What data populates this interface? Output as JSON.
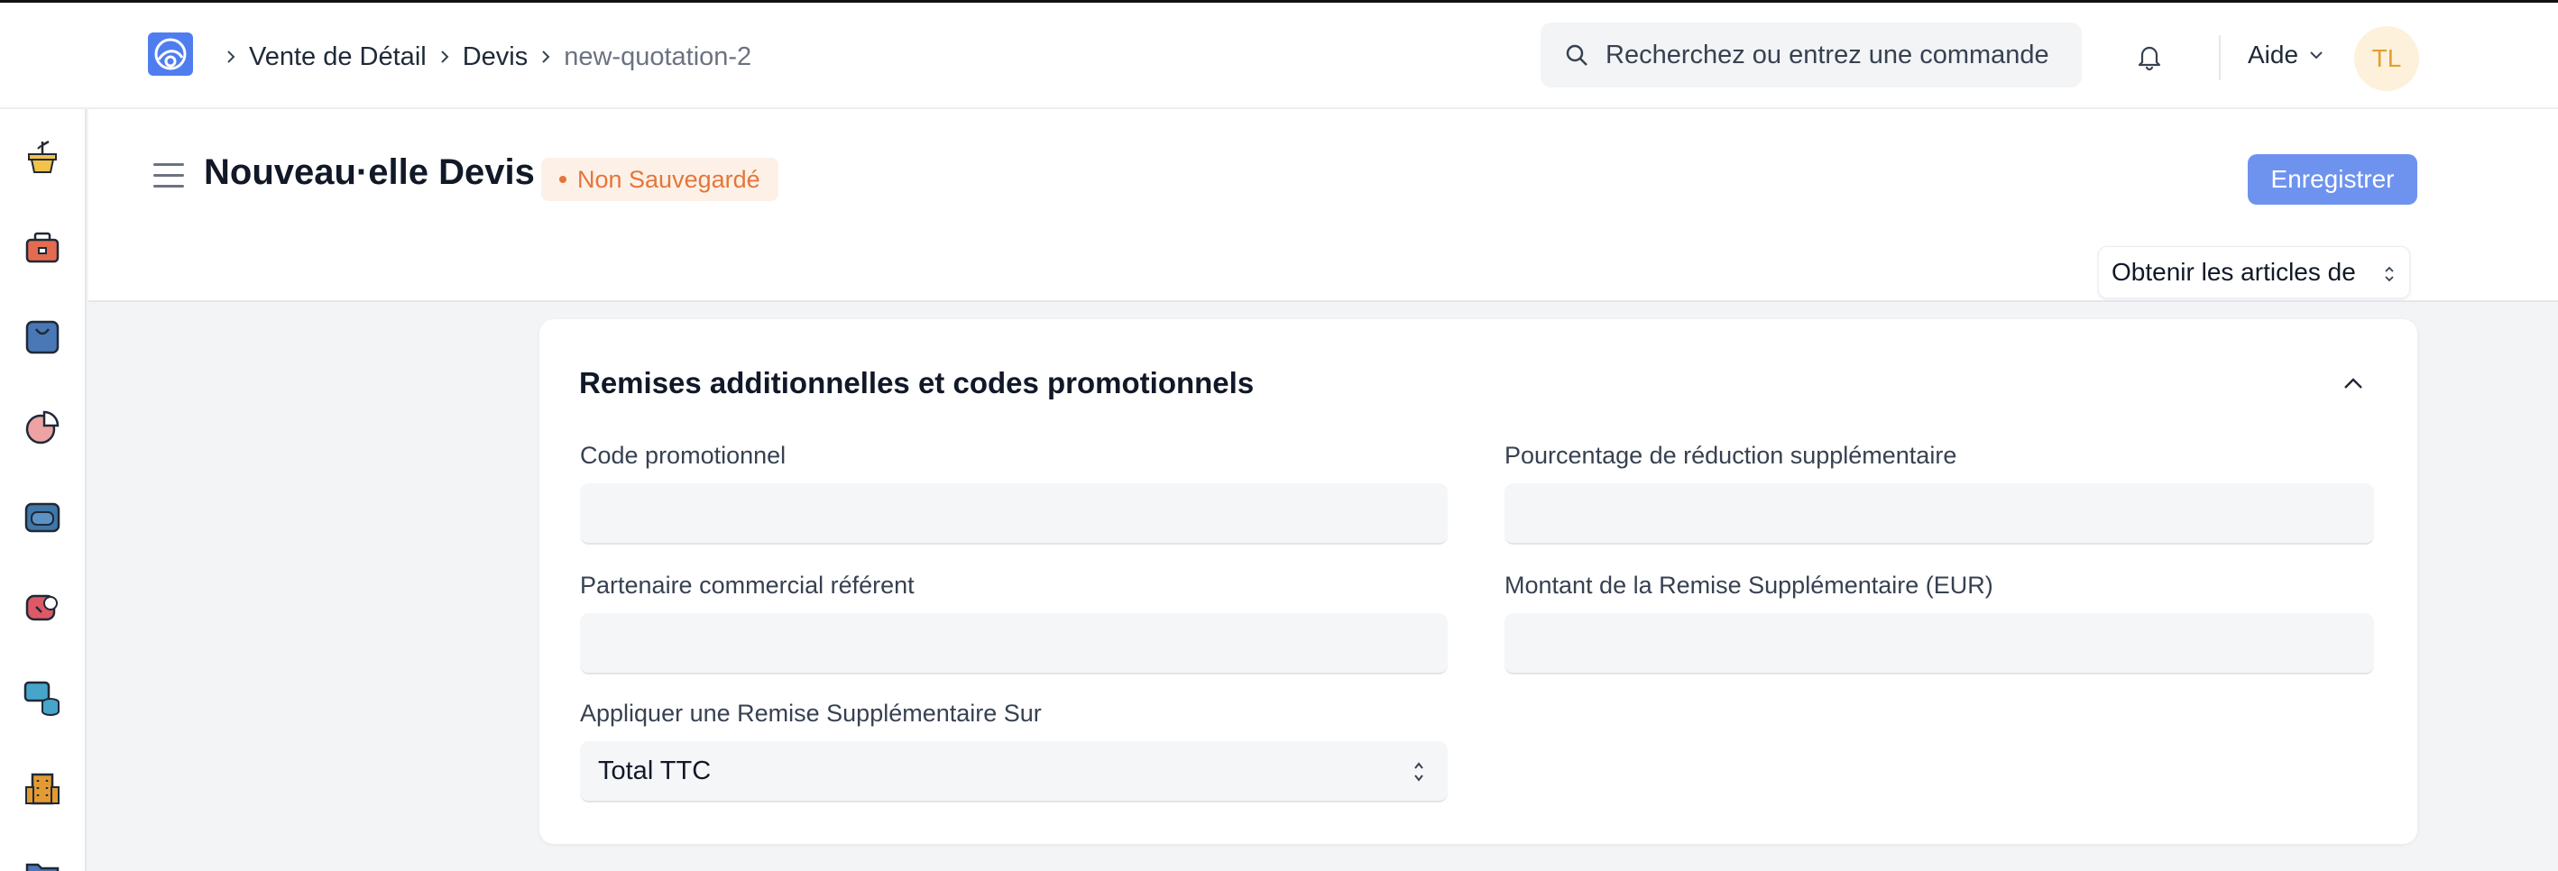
{
  "app": {
    "logo_icon": "frappe-logo-icon",
    "accent_color": "#4f7df0"
  },
  "breadcrumb": {
    "items": [
      "Vente de Détail",
      "Devis",
      "new-quotation-2"
    ]
  },
  "search": {
    "placeholder": "Recherchez ou entrez une commande"
  },
  "navbar": {
    "help_label": "Aide",
    "avatar_initials": "TL"
  },
  "sidebar": {
    "icons": [
      "plant-pot-icon",
      "toolbox-icon",
      "shopping-bag-icon",
      "pie-chart-icon",
      "wallet-icon",
      "support-icon",
      "database-chat-icon",
      "building-icon",
      "folder-icon"
    ]
  },
  "page": {
    "title": "Nouveau·elle Devis",
    "status_badge": "Non Sauvegardé",
    "save_label": "Enregistrer",
    "get_items_label": "Obtenir les articles de"
  },
  "section": {
    "title": "Remises additionnelles et codes promotionnels",
    "fields": {
      "promo_code_label": "Code promotionnel",
      "promo_code_value": "",
      "extra_discount_pct_label": "Pourcentage de réduction supplémentaire",
      "extra_discount_pct_value": "",
      "sales_partner_label": "Partenaire commercial référent",
      "sales_partner_value": "",
      "extra_discount_amount_label": "Montant de la Remise Supplémentaire (EUR)",
      "extra_discount_amount_value": "",
      "apply_discount_on_label": "Appliquer une Remise Supplémentaire Sur",
      "apply_discount_on_value": "Total TTC"
    }
  },
  "colors": {
    "badge_text": "#e5753b",
    "badge_bg": "#fdf1e7",
    "save_button": "#6e93ef",
    "avatar_bg": "#fdf1dc",
    "avatar_text": "#e0a12e"
  }
}
